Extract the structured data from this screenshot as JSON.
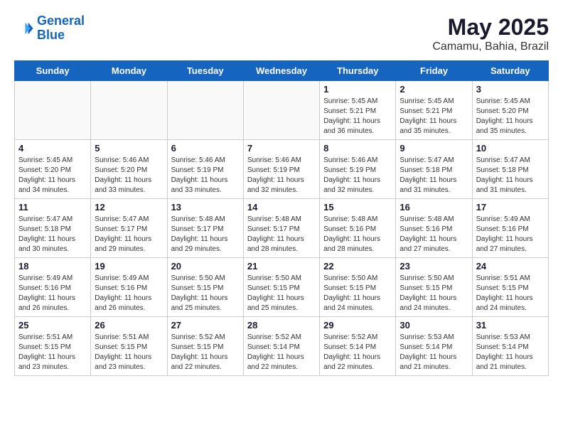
{
  "logo": {
    "line1": "General",
    "line2": "Blue"
  },
  "title": "May 2025",
  "subtitle": "Camamu, Bahia, Brazil",
  "days_of_week": [
    "Sunday",
    "Monday",
    "Tuesday",
    "Wednesday",
    "Thursday",
    "Friday",
    "Saturday"
  ],
  "weeks": [
    [
      {
        "num": "",
        "info": ""
      },
      {
        "num": "",
        "info": ""
      },
      {
        "num": "",
        "info": ""
      },
      {
        "num": "",
        "info": ""
      },
      {
        "num": "1",
        "info": "Sunrise: 5:45 AM\nSunset: 5:21 PM\nDaylight: 11 hours\nand 36 minutes."
      },
      {
        "num": "2",
        "info": "Sunrise: 5:45 AM\nSunset: 5:21 PM\nDaylight: 11 hours\nand 35 minutes."
      },
      {
        "num": "3",
        "info": "Sunrise: 5:45 AM\nSunset: 5:20 PM\nDaylight: 11 hours\nand 35 minutes."
      }
    ],
    [
      {
        "num": "4",
        "info": "Sunrise: 5:45 AM\nSunset: 5:20 PM\nDaylight: 11 hours\nand 34 minutes."
      },
      {
        "num": "5",
        "info": "Sunrise: 5:46 AM\nSunset: 5:20 PM\nDaylight: 11 hours\nand 33 minutes."
      },
      {
        "num": "6",
        "info": "Sunrise: 5:46 AM\nSunset: 5:19 PM\nDaylight: 11 hours\nand 33 minutes."
      },
      {
        "num": "7",
        "info": "Sunrise: 5:46 AM\nSunset: 5:19 PM\nDaylight: 11 hours\nand 32 minutes."
      },
      {
        "num": "8",
        "info": "Sunrise: 5:46 AM\nSunset: 5:19 PM\nDaylight: 11 hours\nand 32 minutes."
      },
      {
        "num": "9",
        "info": "Sunrise: 5:47 AM\nSunset: 5:18 PM\nDaylight: 11 hours\nand 31 minutes."
      },
      {
        "num": "10",
        "info": "Sunrise: 5:47 AM\nSunset: 5:18 PM\nDaylight: 11 hours\nand 31 minutes."
      }
    ],
    [
      {
        "num": "11",
        "info": "Sunrise: 5:47 AM\nSunset: 5:18 PM\nDaylight: 11 hours\nand 30 minutes."
      },
      {
        "num": "12",
        "info": "Sunrise: 5:47 AM\nSunset: 5:17 PM\nDaylight: 11 hours\nand 29 minutes."
      },
      {
        "num": "13",
        "info": "Sunrise: 5:48 AM\nSunset: 5:17 PM\nDaylight: 11 hours\nand 29 minutes."
      },
      {
        "num": "14",
        "info": "Sunrise: 5:48 AM\nSunset: 5:17 PM\nDaylight: 11 hours\nand 28 minutes."
      },
      {
        "num": "15",
        "info": "Sunrise: 5:48 AM\nSunset: 5:16 PM\nDaylight: 11 hours\nand 28 minutes."
      },
      {
        "num": "16",
        "info": "Sunrise: 5:48 AM\nSunset: 5:16 PM\nDaylight: 11 hours\nand 27 minutes."
      },
      {
        "num": "17",
        "info": "Sunrise: 5:49 AM\nSunset: 5:16 PM\nDaylight: 11 hours\nand 27 minutes."
      }
    ],
    [
      {
        "num": "18",
        "info": "Sunrise: 5:49 AM\nSunset: 5:16 PM\nDaylight: 11 hours\nand 26 minutes."
      },
      {
        "num": "19",
        "info": "Sunrise: 5:49 AM\nSunset: 5:16 PM\nDaylight: 11 hours\nand 26 minutes."
      },
      {
        "num": "20",
        "info": "Sunrise: 5:50 AM\nSunset: 5:15 PM\nDaylight: 11 hours\nand 25 minutes."
      },
      {
        "num": "21",
        "info": "Sunrise: 5:50 AM\nSunset: 5:15 PM\nDaylight: 11 hours\nand 25 minutes."
      },
      {
        "num": "22",
        "info": "Sunrise: 5:50 AM\nSunset: 5:15 PM\nDaylight: 11 hours\nand 24 minutes."
      },
      {
        "num": "23",
        "info": "Sunrise: 5:50 AM\nSunset: 5:15 PM\nDaylight: 11 hours\nand 24 minutes."
      },
      {
        "num": "24",
        "info": "Sunrise: 5:51 AM\nSunset: 5:15 PM\nDaylight: 11 hours\nand 24 minutes."
      }
    ],
    [
      {
        "num": "25",
        "info": "Sunrise: 5:51 AM\nSunset: 5:15 PM\nDaylight: 11 hours\nand 23 minutes."
      },
      {
        "num": "26",
        "info": "Sunrise: 5:51 AM\nSunset: 5:15 PM\nDaylight: 11 hours\nand 23 minutes."
      },
      {
        "num": "27",
        "info": "Sunrise: 5:52 AM\nSunset: 5:15 PM\nDaylight: 11 hours\nand 22 minutes."
      },
      {
        "num": "28",
        "info": "Sunrise: 5:52 AM\nSunset: 5:14 PM\nDaylight: 11 hours\nand 22 minutes."
      },
      {
        "num": "29",
        "info": "Sunrise: 5:52 AM\nSunset: 5:14 PM\nDaylight: 11 hours\nand 22 minutes."
      },
      {
        "num": "30",
        "info": "Sunrise: 5:53 AM\nSunset: 5:14 PM\nDaylight: 11 hours\nand 21 minutes."
      },
      {
        "num": "31",
        "info": "Sunrise: 5:53 AM\nSunset: 5:14 PM\nDaylight: 11 hours\nand 21 minutes."
      }
    ]
  ]
}
